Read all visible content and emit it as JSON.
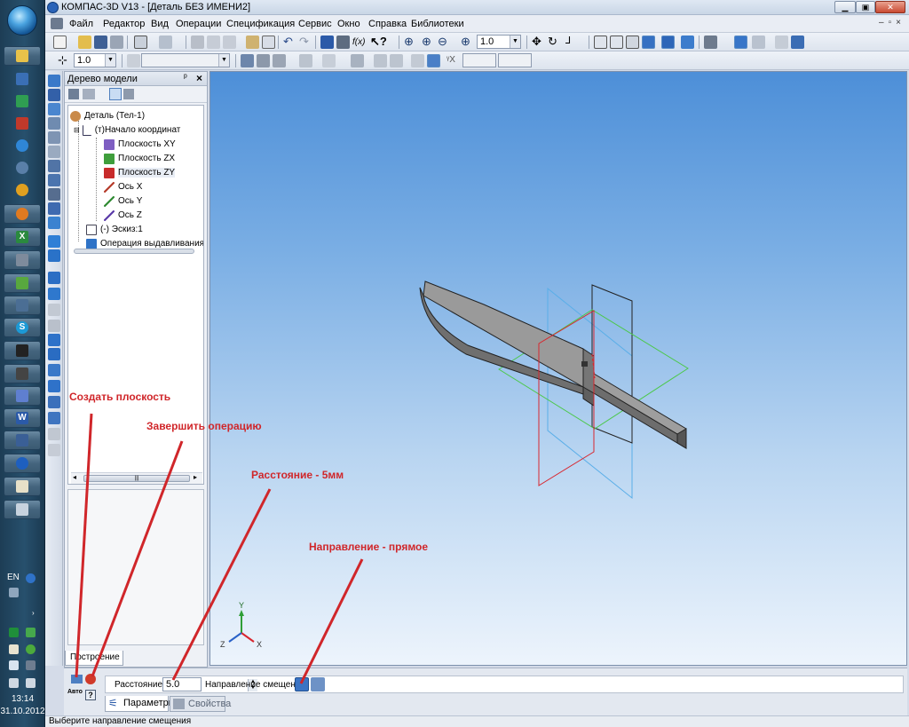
{
  "taskbar": {
    "language": "EN",
    "clock_time": "13:14",
    "clock_date": "31.10.2012"
  },
  "window": {
    "title": "КОМПАС-3D V13 - [Деталь БЕЗ ИМЕНИ2]"
  },
  "menu": [
    "Файл",
    "Редактор",
    "Вид",
    "Операции",
    "Спецификация",
    "Сервис",
    "Окно",
    "Справка",
    "Библиотеки"
  ],
  "toolbar": {
    "zoom_value": "1.0",
    "step_value": "1.0"
  },
  "tree": {
    "title": "Дерево модели",
    "items": [
      {
        "label": "Деталь (Тел-1)"
      },
      {
        "label": "(т)Начало координат"
      },
      {
        "label": "Плоскость XY"
      },
      {
        "label": "Плоскость ZX"
      },
      {
        "label": "Плоскость ZY"
      },
      {
        "label": "Ось X"
      },
      {
        "label": "Ось Y"
      },
      {
        "label": "Ось Z"
      },
      {
        "label": "(-) Эскиз:1"
      },
      {
        "label": "Операция выдавливания"
      }
    ],
    "tab_label": "Построение"
  },
  "properties": {
    "distance_label": "Расстояние",
    "distance_value": "5.0",
    "direction_label": "Направление смещения",
    "tab_params": "Параметры",
    "tab_props": "Свойства",
    "auto_label": "Авто"
  },
  "axes": {
    "x": "X",
    "y": "Y",
    "z": "Z"
  },
  "status": "Выберите направление смещения",
  "annotations": {
    "create_plane": "Создать плоскость",
    "finish_op": "Завершить операцию",
    "distance": "Расстояние - 5мм",
    "direction": "Направление - прямое"
  },
  "colors": {
    "annotation": "#d0262a",
    "plane_blue": "#3b9fe0",
    "plane_red": "#d8262e",
    "plane_green": "#46c24a",
    "model": "#8c8c8c"
  }
}
